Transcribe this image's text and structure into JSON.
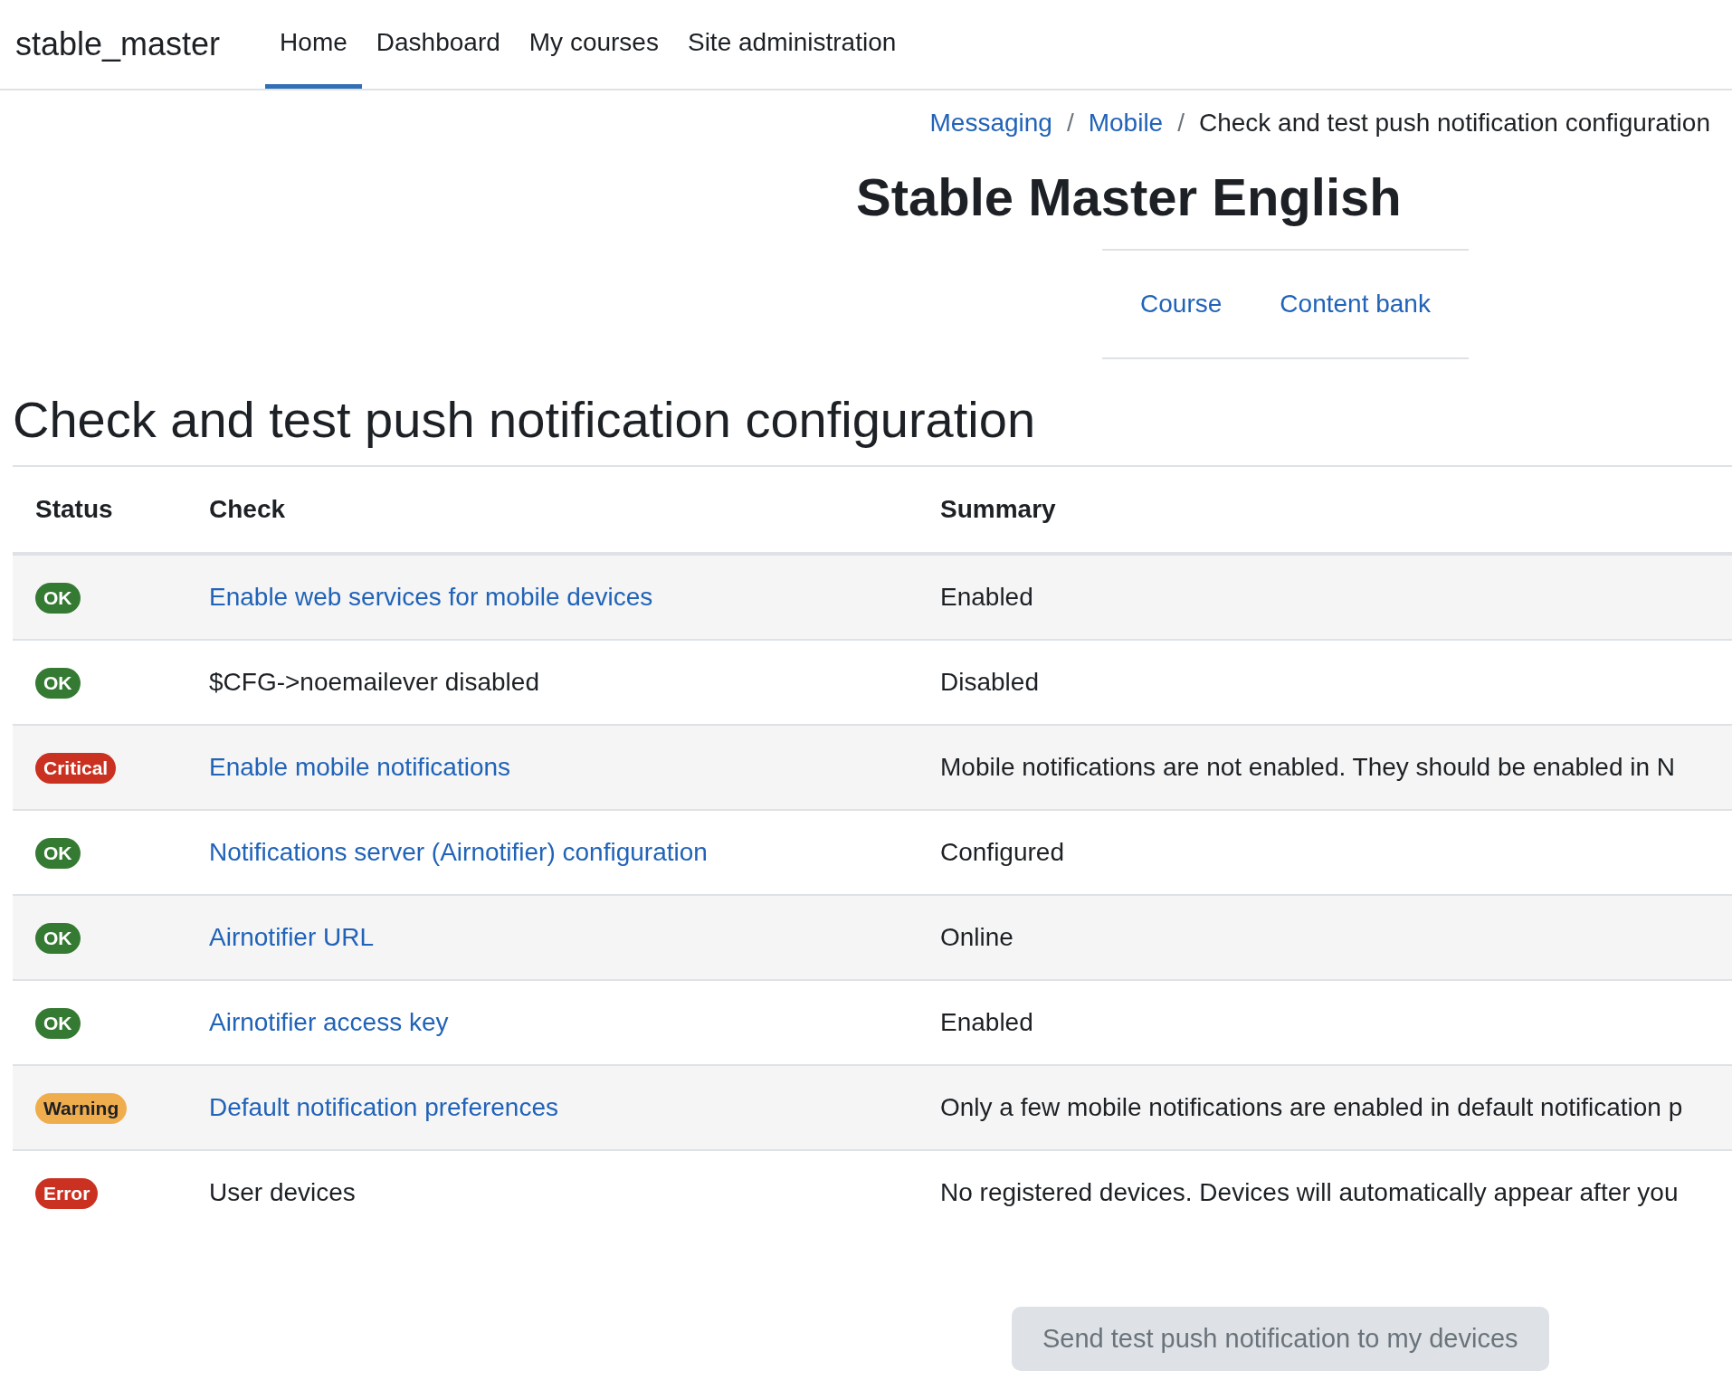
{
  "brand": "stable_master",
  "nav": [
    {
      "label": "Home",
      "selected": true
    },
    {
      "label": "Dashboard",
      "selected": false
    },
    {
      "label": "My courses",
      "selected": false
    },
    {
      "label": "Site administration",
      "selected": false
    }
  ],
  "breadcrumb_separator": "/",
  "breadcrumb": [
    {
      "label": "Messaging",
      "link": true
    },
    {
      "label": "Mobile",
      "link": true
    },
    {
      "label": "Check and test push notification configuration",
      "link": false
    }
  ],
  "course_title": "Stable Master English",
  "secondary_nav": [
    "Course",
    "Content bank"
  ],
  "heading": "Check and test push notification configuration",
  "table": {
    "columns": [
      "Status",
      "Check",
      "Summary"
    ],
    "rows": [
      {
        "status": "OK",
        "kind": "ok",
        "check": "Enable web services for mobile devices",
        "link": true,
        "summary": "Enabled"
      },
      {
        "status": "OK",
        "kind": "ok",
        "check": "$CFG->noemailever disabled",
        "link": false,
        "summary": "Disabled"
      },
      {
        "status": "Critical",
        "kind": "critical",
        "check": "Enable mobile notifications",
        "link": true,
        "summary": "Mobile notifications are not enabled. They should be enabled in N"
      },
      {
        "status": "OK",
        "kind": "ok",
        "check": "Notifications server (Airnotifier) configuration",
        "link": true,
        "summary": "Configured"
      },
      {
        "status": "OK",
        "kind": "ok",
        "check": "Airnotifier URL",
        "link": true,
        "summary": "Online"
      },
      {
        "status": "OK",
        "kind": "ok",
        "check": "Airnotifier access key",
        "link": true,
        "summary": "Enabled"
      },
      {
        "status": "Warning",
        "kind": "warning",
        "check": "Default notification preferences",
        "link": true,
        "summary": "Only a few mobile notifications are enabled in default notification p"
      },
      {
        "status": "Error",
        "kind": "error",
        "check": "User devices",
        "link": false,
        "summary": "No registered devices. Devices will automatically appear after you"
      }
    ]
  },
  "send_button": {
    "label": "Send test push notification to my devices",
    "disabled": true
  }
}
